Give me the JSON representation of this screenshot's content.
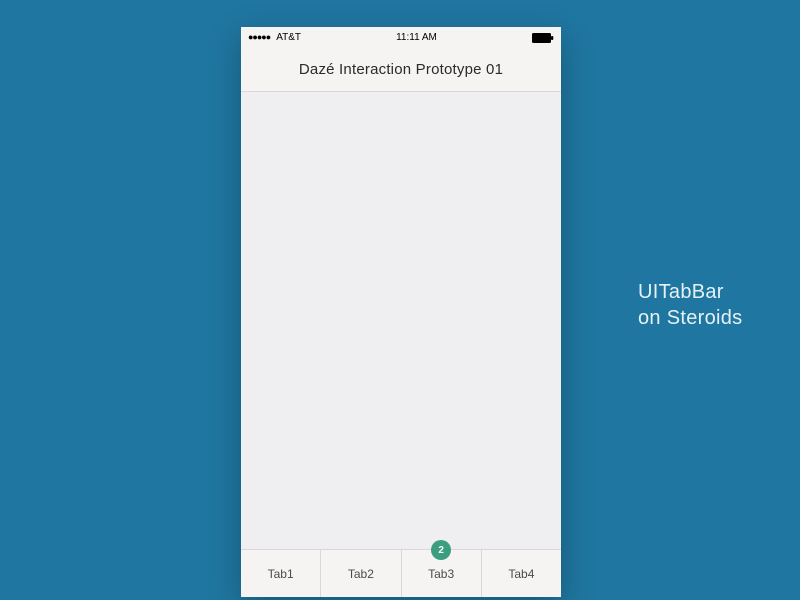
{
  "status_bar": {
    "carrier": "AT&T",
    "time": "11:11 AM"
  },
  "nav": {
    "title": "Dazé Interaction Prototype 01"
  },
  "tabs": [
    {
      "label": "Tab1",
      "badge": null
    },
    {
      "label": "Tab2",
      "badge": null
    },
    {
      "label": "Tab3",
      "badge": "2"
    },
    {
      "label": "Tab4",
      "badge": null
    }
  ],
  "caption": {
    "line1": "UITabBar",
    "line2": "on Steroids"
  }
}
